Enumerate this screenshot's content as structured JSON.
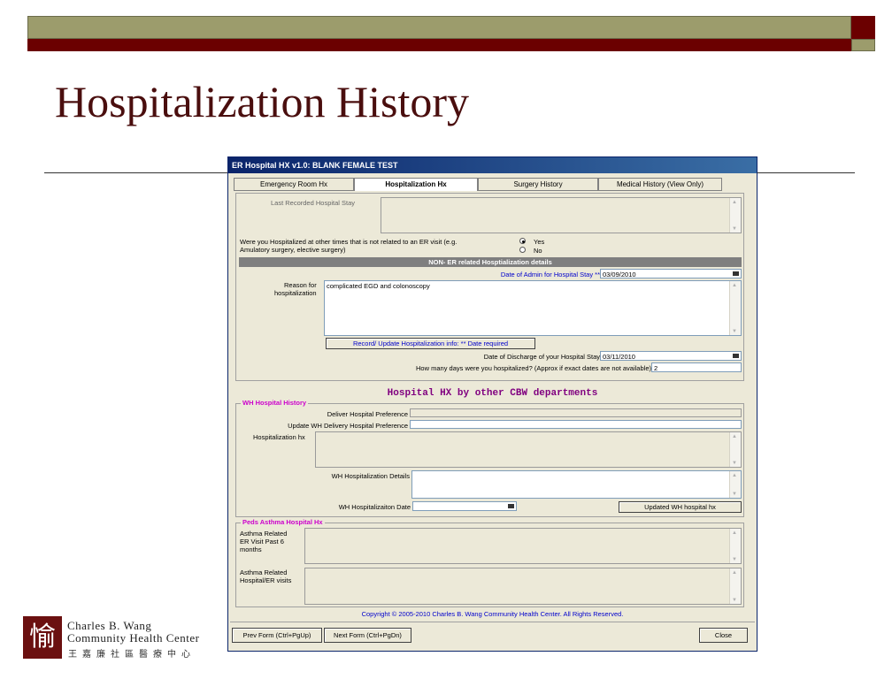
{
  "slide": {
    "title": "Hospitalization History",
    "logo": {
      "glyph": "愉",
      "line1": "Charles B. Wang",
      "line2": "Community Health Center",
      "line3": "王嘉廉社區醫療中心"
    }
  },
  "window": {
    "title": "ER Hospital HX v1.0:  BLANK FEMALE TEST",
    "tabs": [
      "Emergency Room Hx",
      "Hospitalization Hx",
      "Surgery History",
      "Medical History (View Only)"
    ],
    "active_tab": "Hospitalization Hx"
  },
  "form": {
    "last_stay_label": "Last Recorded Hospital Stay",
    "question_line1": "Were you Hospitalized at other times that is not related to an ER visit (e.g.",
    "question_line2": "Amulatory surgery, elective surgery)",
    "radio_yes": "Yes",
    "radio_no": "No",
    "radio_selected": "Yes",
    "section_header": "NON- ER related Hosptialization details",
    "admin_label": "Date of Admin for Hospital Stay **",
    "admin_value": "03/09/2010",
    "reason_label_1": "Reason for",
    "reason_label_2": "hospitalization",
    "reason_value": "complicated EGD and colonoscopy",
    "record_button": "Record/ Update Hospitalization info:  ** Date required",
    "discharge_label": "Date of Discharge of your Hospital Stay",
    "discharge_value": "03/11/2010",
    "days_label": "How many days were you hospitalized? (Approx if exact dates are not available)",
    "days_value": "2",
    "cbw_heading": "Hospital HX by other CBW departments"
  },
  "wh": {
    "group_title": "WH Hospital History",
    "deliver_label": "Deliver Hospital Preference",
    "update_label": "Update WH Delivery Hospital Preference",
    "hx_label": "Hospitalization hx",
    "details_label": "WH Hospitalization Details",
    "date_label": "WH Hospitalizaiton Date",
    "update_button": "Updated WH hospital hx"
  },
  "peds": {
    "group_title": "Peds Asthma Hospital Hx",
    "er_label_1": "Asthma Related",
    "er_label_2": "ER Visit Past 6",
    "er_label_3": "months",
    "hosp_label_1": "Asthma Related",
    "hosp_label_2": "Hospital/ER visits"
  },
  "footer": {
    "copyright": "Copyright © 2005-2010 Charles B. Wang Community Health Center. All Rights Reserved.",
    "prev_button": "Prev Form (Ctrl+PgUp)",
    "next_button": "Next Form (Ctrl+PgDn)",
    "close_button": "Close"
  },
  "colors": {
    "slide_title": "#4a0e0e",
    "accent_red": "#6b0000",
    "accent_olive": "#9c9c6c",
    "titlebar": "#0a246a",
    "group_title": "#cc00cc",
    "heading_purple": "#800080",
    "link_blue": "#0000cc"
  }
}
